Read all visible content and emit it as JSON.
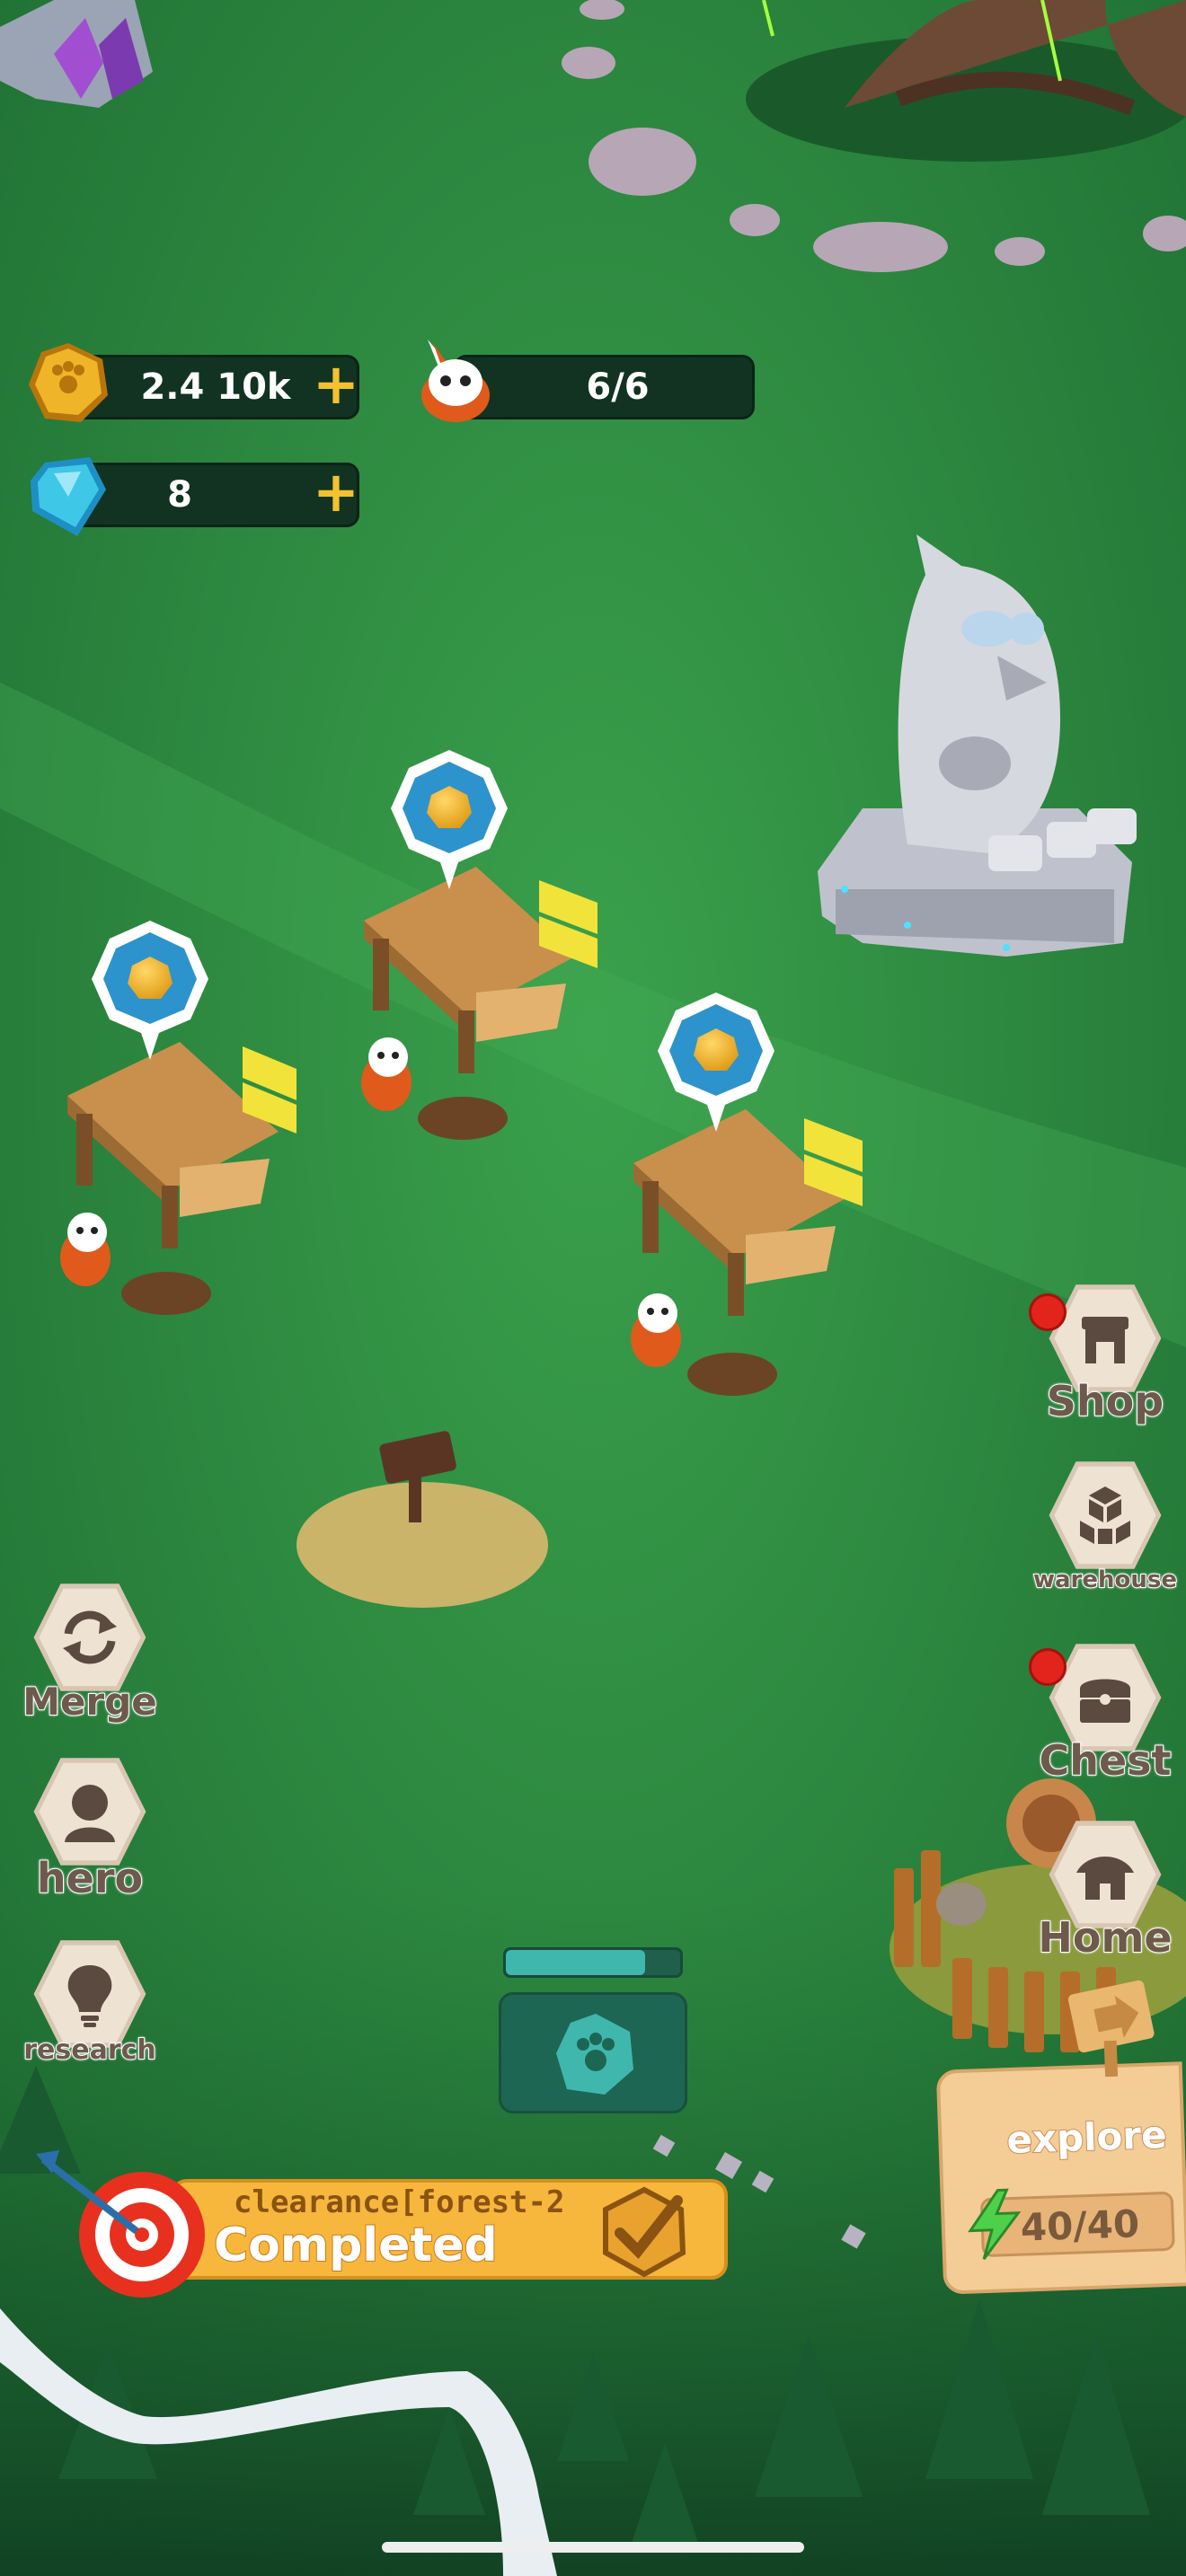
{
  "hud": {
    "coins": {
      "value": "2.4 10k",
      "icon": "coin-icon",
      "add_icon": "plus-icon"
    },
    "workers": {
      "value": "6/6",
      "icon": "worker-icon"
    },
    "gems": {
      "value": "8",
      "icon": "gem-icon",
      "add_icon": "plus-icon"
    }
  },
  "left_menu": [
    {
      "id": "merge",
      "label": "Merge",
      "icon": "merge-icon"
    },
    {
      "id": "hero",
      "label": "hero",
      "icon": "hero-icon"
    },
    {
      "id": "research",
      "label": "research",
      "icon": "lightbulb-icon"
    }
  ],
  "right_menu": [
    {
      "id": "shop",
      "label": "Shop",
      "icon": "shop-icon",
      "notification": true
    },
    {
      "id": "warehouse",
      "label": "warehouse",
      "icon": "crates-icon",
      "notification": false
    },
    {
      "id": "chest",
      "label": "Chest",
      "icon": "chest-icon",
      "notification": true
    },
    {
      "id": "home",
      "label": "Home",
      "icon": "house-icon",
      "notification": false
    }
  ],
  "quest": {
    "title": "clearance[forest-2",
    "status": "Completed",
    "icon": "target-icon",
    "check_icon": "check-icon"
  },
  "explore": {
    "label": "explore",
    "energy": "40/40",
    "energy_icon": "lightning-icon",
    "arrow_icon": "arrow-right-icon"
  },
  "collect": {
    "progress": 0.8,
    "icon": "paw-coin-icon"
  },
  "colors": {
    "grass": "#2d8a3e",
    "hud_bar": "#123322",
    "coin_gold": "#f0b429",
    "gem_blue": "#3fc7e8",
    "quest_orange": "#f7b73c",
    "notification_red": "#e2241c"
  }
}
